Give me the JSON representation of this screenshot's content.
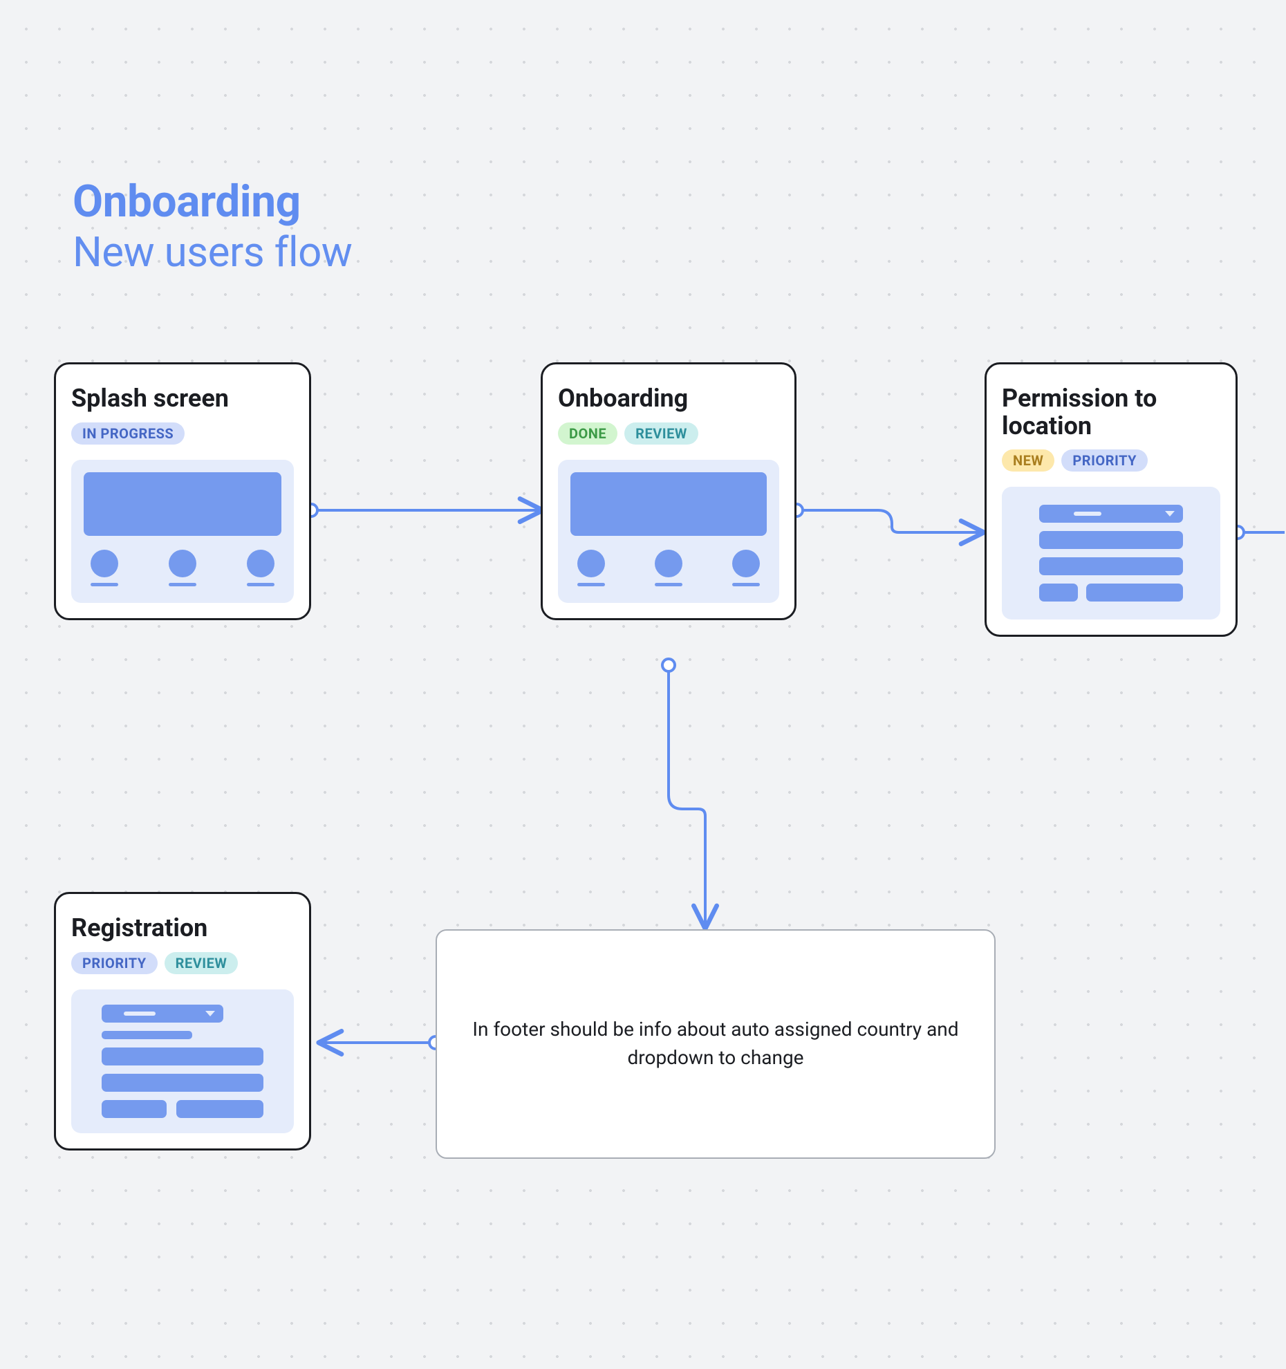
{
  "title": {
    "main": "Onboarding",
    "sub": "New users flow"
  },
  "colors": {
    "accent": "#5f8cf0",
    "card_border": "#1b1d22",
    "preview_bg": "#e5ecfb",
    "preview_fill": "#759aee"
  },
  "badges": {
    "in_progress": "IN PROGRESS",
    "done": "DONE",
    "review": "REVIEW",
    "new": "NEW",
    "priority": "PRIORITY"
  },
  "cards": {
    "splash": {
      "title": "Splash screen",
      "badges": [
        "in_progress"
      ]
    },
    "onboarding": {
      "title": "Onboarding",
      "badges": [
        "done",
        "review"
      ]
    },
    "permission": {
      "title": "Permission to location",
      "badges": [
        "new",
        "priority"
      ]
    },
    "registration": {
      "title": "Registration",
      "badges": [
        "priority",
        "review"
      ]
    }
  },
  "note": {
    "text": "In footer should be info about auto assigned country and dropdown to change"
  }
}
